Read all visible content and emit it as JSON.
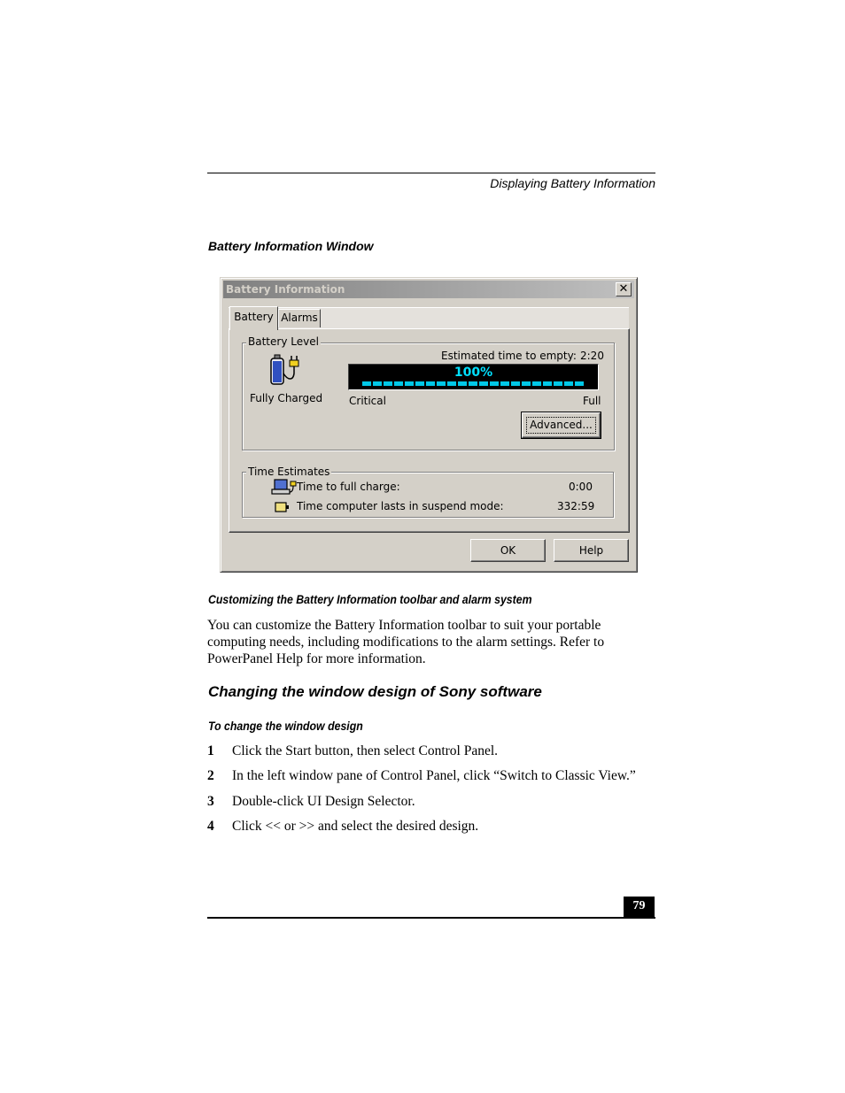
{
  "header": {
    "section_title": "Displaying Battery Information"
  },
  "figure_caption": "Battery Information Window",
  "window": {
    "title": "Battery Information",
    "close_glyph": "✕",
    "tabs": [
      {
        "label": "Battery",
        "active": true
      },
      {
        "label": "Alarms",
        "active": false
      }
    ],
    "battery_level": {
      "group_label": "Battery Level",
      "status": "Fully Charged",
      "estimated_label": "Estimated time to empty:",
      "estimated_value": "2:20",
      "percent_text": "100%",
      "percent_value": 1.0,
      "scale_min_label": "Critical",
      "scale_max_label": "Full",
      "icon": "battery-plug-icon",
      "advanced_button": "Advanced..."
    },
    "time_estimates": {
      "group_label": "Time Estimates",
      "rows": [
        {
          "label": "Time to full charge:",
          "value": "0:00",
          "icon": "laptop-plug-icon"
        },
        {
          "label": "Time computer lasts in suspend mode:",
          "value": "332:59",
          "icon": "battery-small-icon"
        }
      ]
    },
    "buttons": {
      "ok": "OK",
      "help": "Help"
    }
  },
  "sections": {
    "customizing_heading": "Customizing the Battery Information toolbar and alarm system",
    "customizing_body": "You can customize the Battery Information toolbar to suit your portable computing needs, including modifications to the alarm settings. Refer to PowerPanel Help for more information.",
    "changing_heading": "Changing the window design of Sony software",
    "procedure_heading": "To change the window design",
    "steps": [
      {
        "num": "1",
        "text": "Click the Start button, then select Control Panel."
      },
      {
        "num": "2",
        "text": "In the left window pane of Control Panel, click “Switch to Classic View.”"
      },
      {
        "num": "3",
        "text": "Double-click UI Design Selector."
      },
      {
        "num": "4",
        "text": "Click << or >> and select the desired design."
      }
    ]
  },
  "footer": {
    "page_number": "79"
  }
}
